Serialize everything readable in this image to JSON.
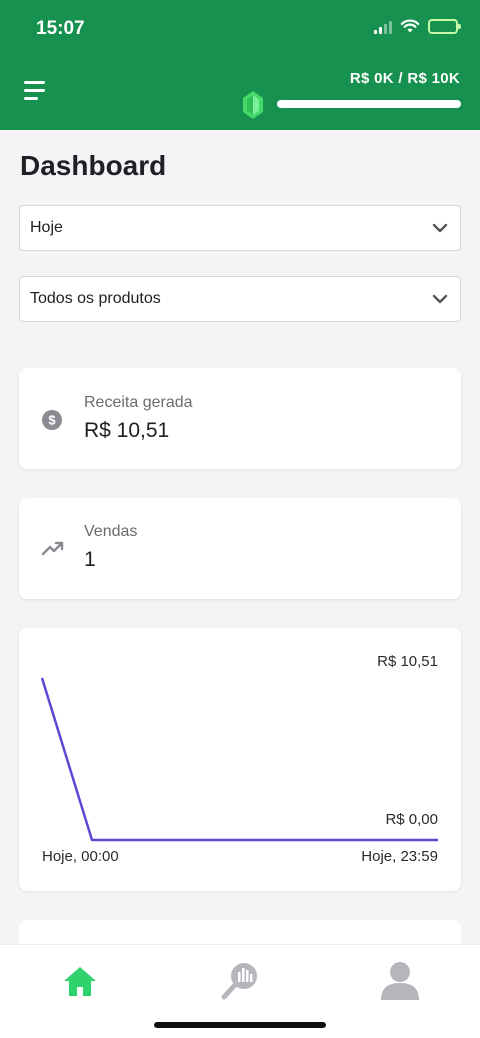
{
  "status_bar": {
    "time": "15:07"
  },
  "header": {
    "goal_text": "R$ 0K / R$ 10K",
    "goal_progress": 0.0,
    "colors": {
      "header_bg": "#17914f",
      "progress_fill": "#5ee47f"
    },
    "icons": {
      "menu": "hamburger-menu-icon",
      "goal": "gem-icon"
    }
  },
  "page": {
    "title": "Dashboard"
  },
  "filters": {
    "period": {
      "value": "Hoje"
    },
    "products": {
      "value": "Todos os produtos"
    }
  },
  "kpis": {
    "revenue": {
      "label": "Receita gerada",
      "value": "R$ 10,51",
      "icon": "dollar-circle-icon"
    },
    "sales": {
      "label": "Vendas",
      "value": "1",
      "icon": "trending-up-icon"
    }
  },
  "chart_data": {
    "type": "line",
    "x": [
      "Hoje, 00:00",
      "Hoje, 23:59"
    ],
    "series": [
      {
        "values": [
          10.51,
          0.0,
          0.0
        ]
      }
    ],
    "y_labels": [
      "R$ 10,51",
      "R$ 0,00"
    ],
    "x_labels": [
      "Hoje, 00:00",
      "Hoje, 23:59"
    ],
    "ylim": [
      0,
      10.51
    ],
    "grid": false,
    "line_color": "#5b49d6"
  },
  "tabbar": {
    "active_color": "#2fd36e",
    "inactive_color": "#b5b5bb",
    "tabs": [
      {
        "icon": "home-icon",
        "active": true
      },
      {
        "icon": "analytics-search-icon",
        "active": false
      },
      {
        "icon": "profile-icon",
        "active": false
      }
    ]
  }
}
